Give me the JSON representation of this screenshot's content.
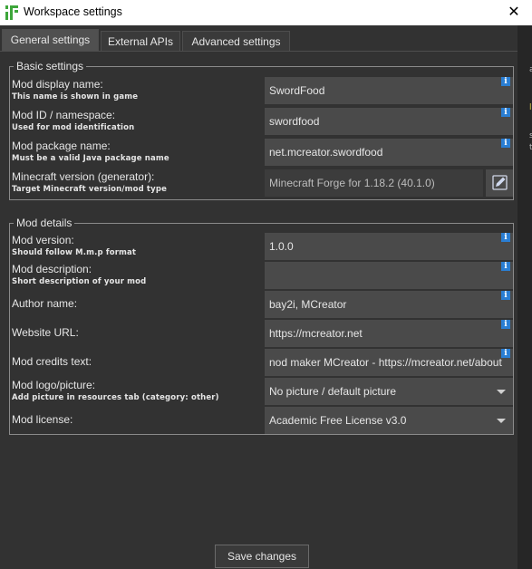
{
  "window": {
    "title": "Workspace settings",
    "close_glyph": "✕"
  },
  "tabs": [
    {
      "label": "General settings",
      "active": true
    },
    {
      "label": "External APIs",
      "active": false
    },
    {
      "label": "Advanced settings",
      "active": false
    }
  ],
  "basic": {
    "legend": "Basic settings",
    "display_name": {
      "label": "Mod display name:",
      "hint": "This name is shown in game",
      "value": "SwordFood"
    },
    "mod_id": {
      "label": "Mod ID / namespace:",
      "hint": "Used for mod identification",
      "value": "swordfood"
    },
    "package": {
      "label": "Mod package name:",
      "hint": "Must be a valid Java package name",
      "value": "net.mcreator.swordfood"
    },
    "mc_version": {
      "label": "Minecraft version (generator):",
      "hint": "Target Minecraft version/mod type",
      "value": "Minecraft Forge for 1.18.2 (40.1.0)"
    }
  },
  "details": {
    "legend": "Mod details",
    "version": {
      "label": "Mod version:",
      "hint": "Should follow M.m.p format",
      "value": "1.0.0"
    },
    "description": {
      "label": "Mod description:",
      "hint": "Short description of your mod",
      "value": ""
    },
    "author": {
      "label": "Author name:",
      "value": "bay2i, MCreator"
    },
    "website": {
      "label": "Website URL:",
      "value": "https://mcreator.net"
    },
    "credits": {
      "label": "Mod credits text:",
      "value": "nod maker MCreator - https://mcreator.net/about"
    },
    "logo": {
      "label": "Mod logo/picture:",
      "hint": "Add picture in resources tab (category: other)",
      "value": "No picture / default picture"
    },
    "license": {
      "label": "Mod license:",
      "value": "Academic Free License v3.0"
    }
  },
  "info_glyph": "i",
  "save_label": "Save changes",
  "side_glyphs": [
    "a",
    "l",
    "s",
    "t"
  ],
  "colors": {
    "background": "#323232",
    "field": "#4a4a4a",
    "info": "#2a7ed3",
    "logo_green": "#3ea63b"
  }
}
